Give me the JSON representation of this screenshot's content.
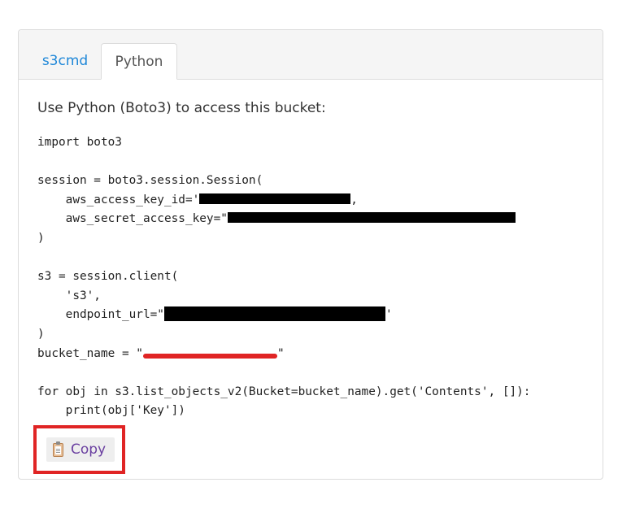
{
  "tabs": [
    {
      "label": "s3cmd",
      "active": false
    },
    {
      "label": "Python",
      "active": true
    }
  ],
  "intro": "Use Python (Boto3) to access this bucket:",
  "code": {
    "line1": "import boto3",
    "line3": "session = boto3.session.Session(",
    "line4_prefix": "    aws_access_key_id='",
    "line4_suffix": ",",
    "line5_prefix": "    aws_secret_access_key=\"",
    "line6": ")",
    "line8": "s3 = session.client(",
    "line9": "    's3',",
    "line10_prefix": "    endpoint_url=\"",
    "line10_suffix": "'",
    "line11": ")",
    "line12_prefix": "bucket_name = \"",
    "line12_suffix": "\"",
    "line14": "for obj in s3.list_objects_v2(Bucket=bucket_name).get('Contents', []):",
    "line15": "    print(obj['Key'])"
  },
  "copy_button": {
    "label": "Copy",
    "icon": "clipboard-icon"
  },
  "colors": {
    "tab_link": "#1e87d8",
    "highlight_border": "#e02424",
    "copy_text": "#6a3fa0"
  }
}
